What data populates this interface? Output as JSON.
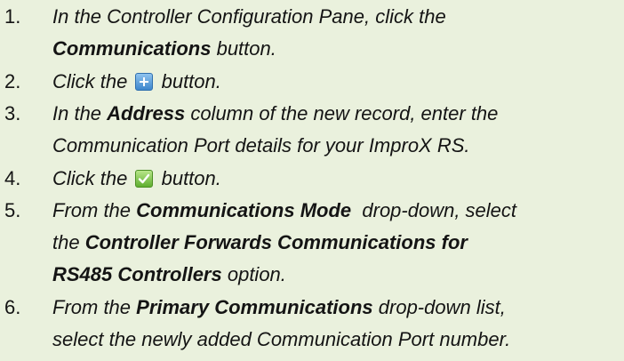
{
  "steps": [
    {
      "number": "1.",
      "line1_a": "In the Controller Configuration Pane, click the",
      "line2_bold": "Communications",
      "line2_b": " button."
    },
    {
      "number": "2.",
      "before": "Click the ",
      "icon": "add-record-icon",
      "after": " button."
    },
    {
      "number": "3.",
      "line1_a": "In the ",
      "line1_bold": "Address",
      "line1_b": " column of the new record, enter the",
      "line2": "Communication Port details for your ImproX RS."
    },
    {
      "number": "4.",
      "before": "Click the ",
      "icon": "save-check-icon",
      "after": " button."
    },
    {
      "number": "5.",
      "line1_a": "From the ",
      "line1_bold": "Communications Mode",
      "line1_b": "  drop-down, select",
      "line2_a": "the ",
      "line2_bold": "Controller Forwards Communications for",
      "line3_bold": "RS485 Controllers",
      "line3_b": " option."
    },
    {
      "number": "6.",
      "line1_a": "From the ",
      "line1_bold": "Primary Communications",
      "line1_b": " drop-down list,",
      "line2": "select the newly added Communication Port number."
    }
  ],
  "colors": {
    "background": "#eaf1dd",
    "text": "#141414",
    "add_icon": "#3d86cc",
    "check_icon": "#5fae2f"
  }
}
